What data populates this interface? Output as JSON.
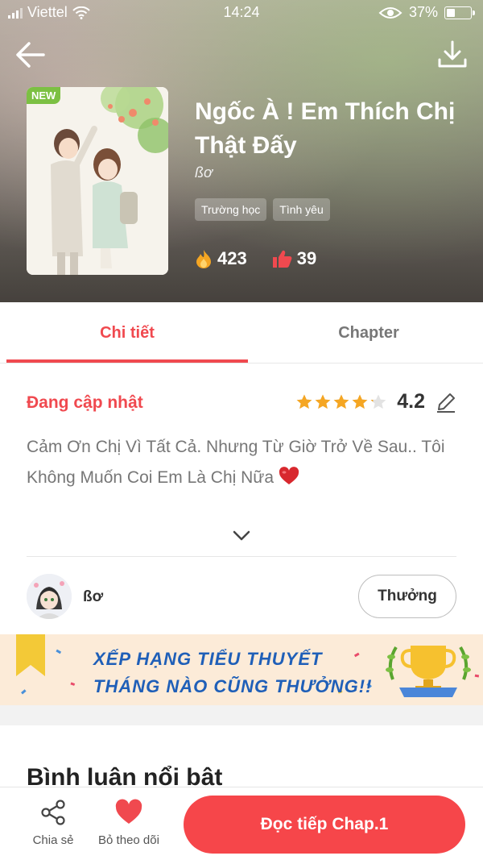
{
  "status_bar": {
    "carrier": "Viettel",
    "time": "14:24",
    "battery_percent": "37%",
    "battery_level": 0.37
  },
  "header": {
    "back_icon": "arrow-left-icon",
    "download_icon": "download-icon"
  },
  "book": {
    "badge": "NEW",
    "title": "Ngốc À ! Em Thích Chị Thật Đấy",
    "author": "ßơ",
    "genres": [
      "Trường học",
      "Tình yêu"
    ],
    "views": "423",
    "likes": "39"
  },
  "tabs": [
    {
      "label": "Chi tiết",
      "active": true
    },
    {
      "label": "Chapter",
      "active": false
    }
  ],
  "detail": {
    "status": "Đang cập nhật",
    "rating": "4.2",
    "rating_stars": 4.2,
    "description": "Cảm Ơn Chị Vì Tất Cả. Nhưng Từ Giờ Trở Về Sau.. Tôi Không Muốn Coi Em Là Chị Nữa",
    "description_emoji": "heart"
  },
  "author_row": {
    "name": "ßơ",
    "reward_label": "Thưởng"
  },
  "banner": {
    "line1": "XẾP HẠNG TIỂU THUYẾT",
    "line2": "THÁNG NÀO CŨNG THƯỞNG!!"
  },
  "comments": {
    "title": "Bình luận nổi bật"
  },
  "bottom_bar": {
    "share_label": "Chia sẻ",
    "unfollow_label": "Bỏ theo dõi",
    "read_label": "Đọc tiếp Chap.1"
  },
  "colors": {
    "accent": "#f0494f",
    "read_button": "#f6464a",
    "banner_bg": "#fcebd8",
    "banner_text": "#1f5fb8",
    "star": "#f5a623"
  }
}
